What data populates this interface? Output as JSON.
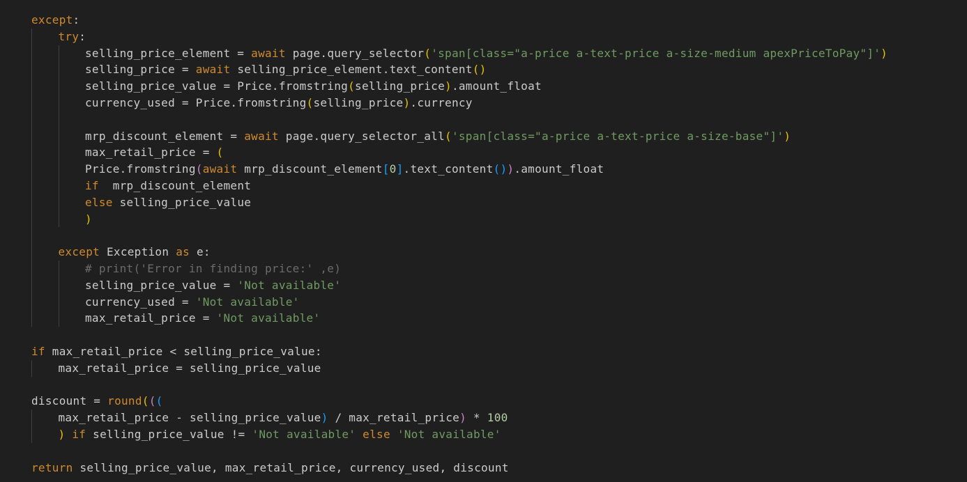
{
  "editor": {
    "theme": {
      "background": "#1f1f1f",
      "default_text": "#cccccc",
      "keyword": "#d08a2e",
      "string": "#6f9b62",
      "number": "#b5cea8",
      "comment": "#6b6b6b",
      "bracket_level_1": "#e6c300",
      "bracket_level_2": "#c586c0",
      "bracket_level_3": "#179fff",
      "indent_guide": "#404040"
    },
    "lines": [
      {
        "indent": 0,
        "tokens": [
          [
            "ctl",
            "except"
          ],
          [
            "id",
            ":"
          ]
        ]
      },
      {
        "indent": 1,
        "tokens": [
          [
            "ctl",
            "try"
          ],
          [
            "id",
            ":"
          ]
        ]
      },
      {
        "indent": 2,
        "tokens": [
          [
            "id",
            "selling_price_element = "
          ],
          [
            "kw",
            "await"
          ],
          [
            "id",
            " page.query_selector"
          ],
          [
            "p1",
            "("
          ],
          [
            "strg",
            "'span[class=\"a-price a-text-price a-size-medium apexPriceToPay\"]'"
          ],
          [
            "p1",
            ")"
          ]
        ]
      },
      {
        "indent": 2,
        "tokens": [
          [
            "id",
            "selling_price = "
          ],
          [
            "kw",
            "await"
          ],
          [
            "id",
            " selling_price_element.text_content"
          ],
          [
            "p1",
            "()"
          ]
        ]
      },
      {
        "indent": 2,
        "tokens": [
          [
            "id",
            "selling_price_value = Price.fromstring"
          ],
          [
            "p1",
            "("
          ],
          [
            "id",
            "selling_price"
          ],
          [
            "p1",
            ")"
          ],
          [
            "id",
            ".amount_float"
          ]
        ]
      },
      {
        "indent": 2,
        "tokens": [
          [
            "id",
            "currency_used = Price.fromstring"
          ],
          [
            "p1",
            "("
          ],
          [
            "id",
            "selling_price"
          ],
          [
            "p1",
            ")"
          ],
          [
            "id",
            ".currency"
          ]
        ]
      },
      {
        "indent": 0,
        "tokens": []
      },
      {
        "indent": 2,
        "tokens": [
          [
            "id",
            "mrp_discount_element = "
          ],
          [
            "kw",
            "await"
          ],
          [
            "id",
            " page.query_selector_all"
          ],
          [
            "p1",
            "("
          ],
          [
            "strg",
            "'span[class=\"a-price a-text-price a-size-base\"]'"
          ],
          [
            "p1",
            ")"
          ]
        ]
      },
      {
        "indent": 2,
        "tokens": [
          [
            "id",
            "max_retail_price = "
          ],
          [
            "p1",
            "("
          ]
        ]
      },
      {
        "indent": 2,
        "tokens": [
          [
            "id",
            "Price.fromstring"
          ],
          [
            "p2",
            "("
          ],
          [
            "kw",
            "await"
          ],
          [
            "id",
            " mrp_discount_element"
          ],
          [
            "p3",
            "["
          ],
          [
            "num",
            "0"
          ],
          [
            "p3",
            "]"
          ],
          [
            "id",
            ".text_content"
          ],
          [
            "p3",
            "()"
          ],
          [
            "p2",
            ")"
          ],
          [
            "id",
            ".amount_float"
          ]
        ]
      },
      {
        "indent": 2,
        "tokens": [
          [
            "ctl",
            "if"
          ],
          [
            "id",
            "  mrp_discount_element"
          ]
        ]
      },
      {
        "indent": 2,
        "tokens": [
          [
            "ctl",
            "else"
          ],
          [
            "id",
            " selling_price_value"
          ]
        ]
      },
      {
        "indent": 2,
        "tokens": [
          [
            "p1",
            ")"
          ]
        ]
      },
      {
        "indent": 0,
        "tokens": []
      },
      {
        "indent": 1,
        "tokens": [
          [
            "ctl",
            "except"
          ],
          [
            "id",
            " Exception "
          ],
          [
            "ctl",
            "as"
          ],
          [
            "id",
            " e:"
          ]
        ]
      },
      {
        "indent": 2,
        "tokens": [
          [
            "cmt",
            "# print('Error in finding price:' ,e)"
          ]
        ]
      },
      {
        "indent": 2,
        "tokens": [
          [
            "id",
            "selling_price_value = "
          ],
          [
            "strg",
            "'Not available'"
          ]
        ]
      },
      {
        "indent": 2,
        "tokens": [
          [
            "id",
            "currency_used = "
          ],
          [
            "strg",
            "'Not available'"
          ]
        ]
      },
      {
        "indent": 2,
        "tokens": [
          [
            "id",
            "max_retail_price = "
          ],
          [
            "strg",
            "'Not available'"
          ]
        ]
      },
      {
        "indent": 0,
        "tokens": []
      },
      {
        "indent": 0,
        "tokens": [
          [
            "ctl",
            "if"
          ],
          [
            "id",
            " max_retail_price < selling_price_value:"
          ]
        ]
      },
      {
        "indent": 1,
        "tokens": [
          [
            "id",
            "max_retail_price = selling_price_value"
          ]
        ]
      },
      {
        "indent": 0,
        "tokens": []
      },
      {
        "indent": 0,
        "tokens": [
          [
            "id",
            "discount = "
          ],
          [
            "kw",
            "round"
          ],
          [
            "p1",
            "("
          ],
          [
            "p2",
            "("
          ],
          [
            "p3",
            "("
          ]
        ]
      },
      {
        "indent": 1,
        "tokens": [
          [
            "id",
            "max_retail_price - selling_price_value"
          ],
          [
            "p3",
            ")"
          ],
          [
            "id",
            " / max_retail_price"
          ],
          [
            "p2",
            ")"
          ],
          [
            "id",
            " * "
          ],
          [
            "num",
            "100"
          ]
        ]
      },
      {
        "indent": 1,
        "tokens": [
          [
            "p1",
            ")"
          ],
          [
            "id",
            " "
          ],
          [
            "ctl",
            "if"
          ],
          [
            "id",
            " selling_price_value != "
          ],
          [
            "strg",
            "'Not available'"
          ],
          [
            "id",
            " "
          ],
          [
            "ctl",
            "else"
          ],
          [
            "id",
            " "
          ],
          [
            "strg",
            "'Not available'"
          ]
        ]
      },
      {
        "indent": 0,
        "tokens": []
      },
      {
        "indent": 0,
        "tokens": [
          [
            "ctl",
            "return"
          ],
          [
            "id",
            " selling_price_value, max_retail_price, currency_used, discount"
          ]
        ]
      }
    ]
  }
}
